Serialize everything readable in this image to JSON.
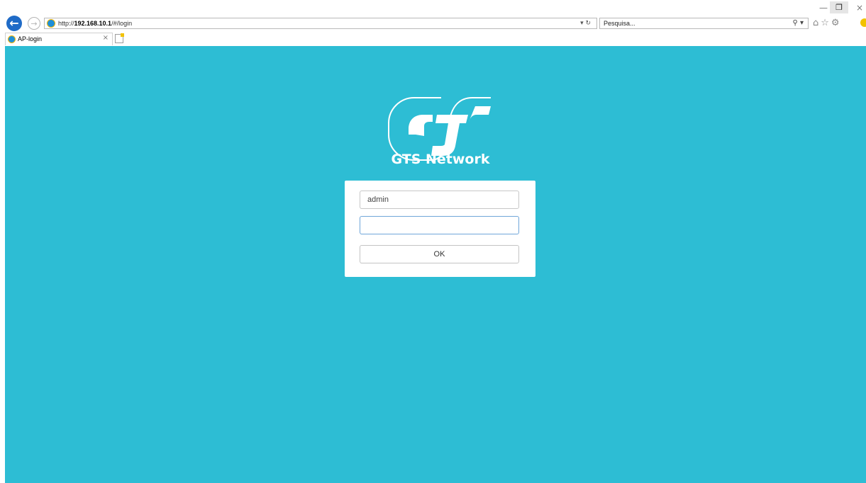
{
  "browser": {
    "url_prefix": "http://",
    "url_host": "192.168.10.1",
    "url_path": "/#/login",
    "address_controls": "▾ ↻",
    "search_placeholder": "Pesquisa...",
    "search_controls": "⚲ ▾",
    "tab_title": "AP-login",
    "tab_close": "×",
    "toolbar_icons": "⌂☆⚙",
    "window_min": "—",
    "window_restore": "❐",
    "window_close": "×"
  },
  "login": {
    "brand": "GTS Network",
    "username_value": "admin",
    "password_value": "",
    "ok_label": "OK"
  },
  "colors": {
    "page_background": "#2dbdd4",
    "card_background": "#ffffff"
  }
}
